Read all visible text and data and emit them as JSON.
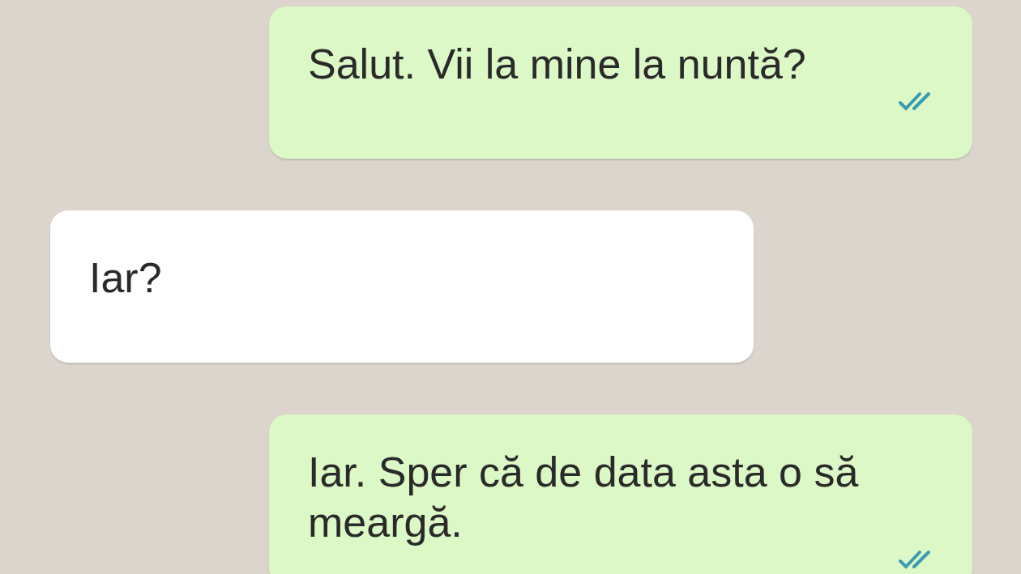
{
  "messages": [
    {
      "kind": "outgoing",
      "text": "Salut. Vii la mine la nuntă?",
      "read": true
    },
    {
      "kind": "incoming",
      "text": "Iar?"
    },
    {
      "kind": "outgoing",
      "text": "Iar. Sper că de data asta o să meargă.",
      "read": true
    }
  ]
}
